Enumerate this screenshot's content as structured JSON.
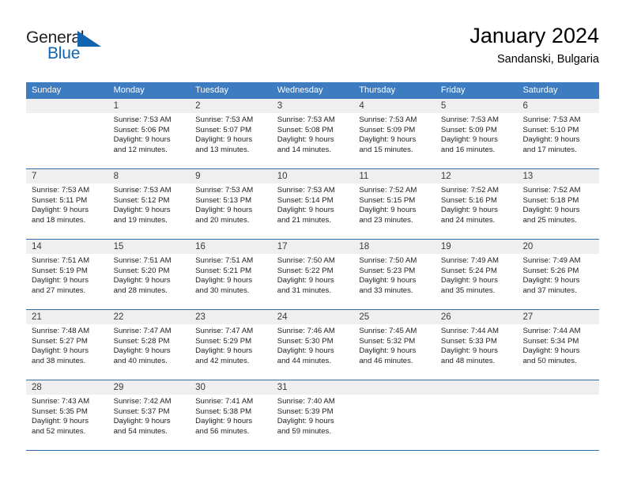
{
  "brand": {
    "word_one": "General",
    "word_two": "Blue",
    "triangle_icon": "triangle-icon",
    "colors": {
      "dark": "#231f20",
      "blue": "#1263b0"
    }
  },
  "header": {
    "title": "January 2024",
    "subtitle": "Sandanski, Bulgaria"
  },
  "colors": {
    "header_blue": "#3d7cc0",
    "rule_blue": "#2e6da8",
    "daynum_bg": "#efefef",
    "text": "#222222"
  },
  "weekday_headers": [
    "Sunday",
    "Monday",
    "Tuesday",
    "Wednesday",
    "Thursday",
    "Friday",
    "Saturday"
  ],
  "weeks": [
    [
      {
        "day": ""
      },
      {
        "day": "1",
        "sunrise": "Sunrise: 7:53 AM",
        "sunset": "Sunset: 5:06 PM",
        "daylight1": "Daylight: 9 hours",
        "daylight2": "and 12 minutes."
      },
      {
        "day": "2",
        "sunrise": "Sunrise: 7:53 AM",
        "sunset": "Sunset: 5:07 PM",
        "daylight1": "Daylight: 9 hours",
        "daylight2": "and 13 minutes."
      },
      {
        "day": "3",
        "sunrise": "Sunrise: 7:53 AM",
        "sunset": "Sunset: 5:08 PM",
        "daylight1": "Daylight: 9 hours",
        "daylight2": "and 14 minutes."
      },
      {
        "day": "4",
        "sunrise": "Sunrise: 7:53 AM",
        "sunset": "Sunset: 5:09 PM",
        "daylight1": "Daylight: 9 hours",
        "daylight2": "and 15 minutes."
      },
      {
        "day": "5",
        "sunrise": "Sunrise: 7:53 AM",
        "sunset": "Sunset: 5:09 PM",
        "daylight1": "Daylight: 9 hours",
        "daylight2": "and 16 minutes."
      },
      {
        "day": "6",
        "sunrise": "Sunrise: 7:53 AM",
        "sunset": "Sunset: 5:10 PM",
        "daylight1": "Daylight: 9 hours",
        "daylight2": "and 17 minutes."
      }
    ],
    [
      {
        "day": "7",
        "sunrise": "Sunrise: 7:53 AM",
        "sunset": "Sunset: 5:11 PM",
        "daylight1": "Daylight: 9 hours",
        "daylight2": "and 18 minutes."
      },
      {
        "day": "8",
        "sunrise": "Sunrise: 7:53 AM",
        "sunset": "Sunset: 5:12 PM",
        "daylight1": "Daylight: 9 hours",
        "daylight2": "and 19 minutes."
      },
      {
        "day": "9",
        "sunrise": "Sunrise: 7:53 AM",
        "sunset": "Sunset: 5:13 PM",
        "daylight1": "Daylight: 9 hours",
        "daylight2": "and 20 minutes."
      },
      {
        "day": "10",
        "sunrise": "Sunrise: 7:53 AM",
        "sunset": "Sunset: 5:14 PM",
        "daylight1": "Daylight: 9 hours",
        "daylight2": "and 21 minutes."
      },
      {
        "day": "11",
        "sunrise": "Sunrise: 7:52 AM",
        "sunset": "Sunset: 5:15 PM",
        "daylight1": "Daylight: 9 hours",
        "daylight2": "and 23 minutes."
      },
      {
        "day": "12",
        "sunrise": "Sunrise: 7:52 AM",
        "sunset": "Sunset: 5:16 PM",
        "daylight1": "Daylight: 9 hours",
        "daylight2": "and 24 minutes."
      },
      {
        "day": "13",
        "sunrise": "Sunrise: 7:52 AM",
        "sunset": "Sunset: 5:18 PM",
        "daylight1": "Daylight: 9 hours",
        "daylight2": "and 25 minutes."
      }
    ],
    [
      {
        "day": "14",
        "sunrise": "Sunrise: 7:51 AM",
        "sunset": "Sunset: 5:19 PM",
        "daylight1": "Daylight: 9 hours",
        "daylight2": "and 27 minutes."
      },
      {
        "day": "15",
        "sunrise": "Sunrise: 7:51 AM",
        "sunset": "Sunset: 5:20 PM",
        "daylight1": "Daylight: 9 hours",
        "daylight2": "and 28 minutes."
      },
      {
        "day": "16",
        "sunrise": "Sunrise: 7:51 AM",
        "sunset": "Sunset: 5:21 PM",
        "daylight1": "Daylight: 9 hours",
        "daylight2": "and 30 minutes."
      },
      {
        "day": "17",
        "sunrise": "Sunrise: 7:50 AM",
        "sunset": "Sunset: 5:22 PM",
        "daylight1": "Daylight: 9 hours",
        "daylight2": "and 31 minutes."
      },
      {
        "day": "18",
        "sunrise": "Sunrise: 7:50 AM",
        "sunset": "Sunset: 5:23 PM",
        "daylight1": "Daylight: 9 hours",
        "daylight2": "and 33 minutes."
      },
      {
        "day": "19",
        "sunrise": "Sunrise: 7:49 AM",
        "sunset": "Sunset: 5:24 PM",
        "daylight1": "Daylight: 9 hours",
        "daylight2": "and 35 minutes."
      },
      {
        "day": "20",
        "sunrise": "Sunrise: 7:49 AM",
        "sunset": "Sunset: 5:26 PM",
        "daylight1": "Daylight: 9 hours",
        "daylight2": "and 37 minutes."
      }
    ],
    [
      {
        "day": "21",
        "sunrise": "Sunrise: 7:48 AM",
        "sunset": "Sunset: 5:27 PM",
        "daylight1": "Daylight: 9 hours",
        "daylight2": "and 38 minutes."
      },
      {
        "day": "22",
        "sunrise": "Sunrise: 7:47 AM",
        "sunset": "Sunset: 5:28 PM",
        "daylight1": "Daylight: 9 hours",
        "daylight2": "and 40 minutes."
      },
      {
        "day": "23",
        "sunrise": "Sunrise: 7:47 AM",
        "sunset": "Sunset: 5:29 PM",
        "daylight1": "Daylight: 9 hours",
        "daylight2": "and 42 minutes."
      },
      {
        "day": "24",
        "sunrise": "Sunrise: 7:46 AM",
        "sunset": "Sunset: 5:30 PM",
        "daylight1": "Daylight: 9 hours",
        "daylight2": "and 44 minutes."
      },
      {
        "day": "25",
        "sunrise": "Sunrise: 7:45 AM",
        "sunset": "Sunset: 5:32 PM",
        "daylight1": "Daylight: 9 hours",
        "daylight2": "and 46 minutes."
      },
      {
        "day": "26",
        "sunrise": "Sunrise: 7:44 AM",
        "sunset": "Sunset: 5:33 PM",
        "daylight1": "Daylight: 9 hours",
        "daylight2": "and 48 minutes."
      },
      {
        "day": "27",
        "sunrise": "Sunrise: 7:44 AM",
        "sunset": "Sunset: 5:34 PM",
        "daylight1": "Daylight: 9 hours",
        "daylight2": "and 50 minutes."
      }
    ],
    [
      {
        "day": "28",
        "sunrise": "Sunrise: 7:43 AM",
        "sunset": "Sunset: 5:35 PM",
        "daylight1": "Daylight: 9 hours",
        "daylight2": "and 52 minutes."
      },
      {
        "day": "29",
        "sunrise": "Sunrise: 7:42 AM",
        "sunset": "Sunset: 5:37 PM",
        "daylight1": "Daylight: 9 hours",
        "daylight2": "and 54 minutes."
      },
      {
        "day": "30",
        "sunrise": "Sunrise: 7:41 AM",
        "sunset": "Sunset: 5:38 PM",
        "daylight1": "Daylight: 9 hours",
        "daylight2": "and 56 minutes."
      },
      {
        "day": "31",
        "sunrise": "Sunrise: 7:40 AM",
        "sunset": "Sunset: 5:39 PM",
        "daylight1": "Daylight: 9 hours",
        "daylight2": "and 59 minutes."
      },
      {
        "day": ""
      },
      {
        "day": ""
      },
      {
        "day": ""
      }
    ]
  ]
}
